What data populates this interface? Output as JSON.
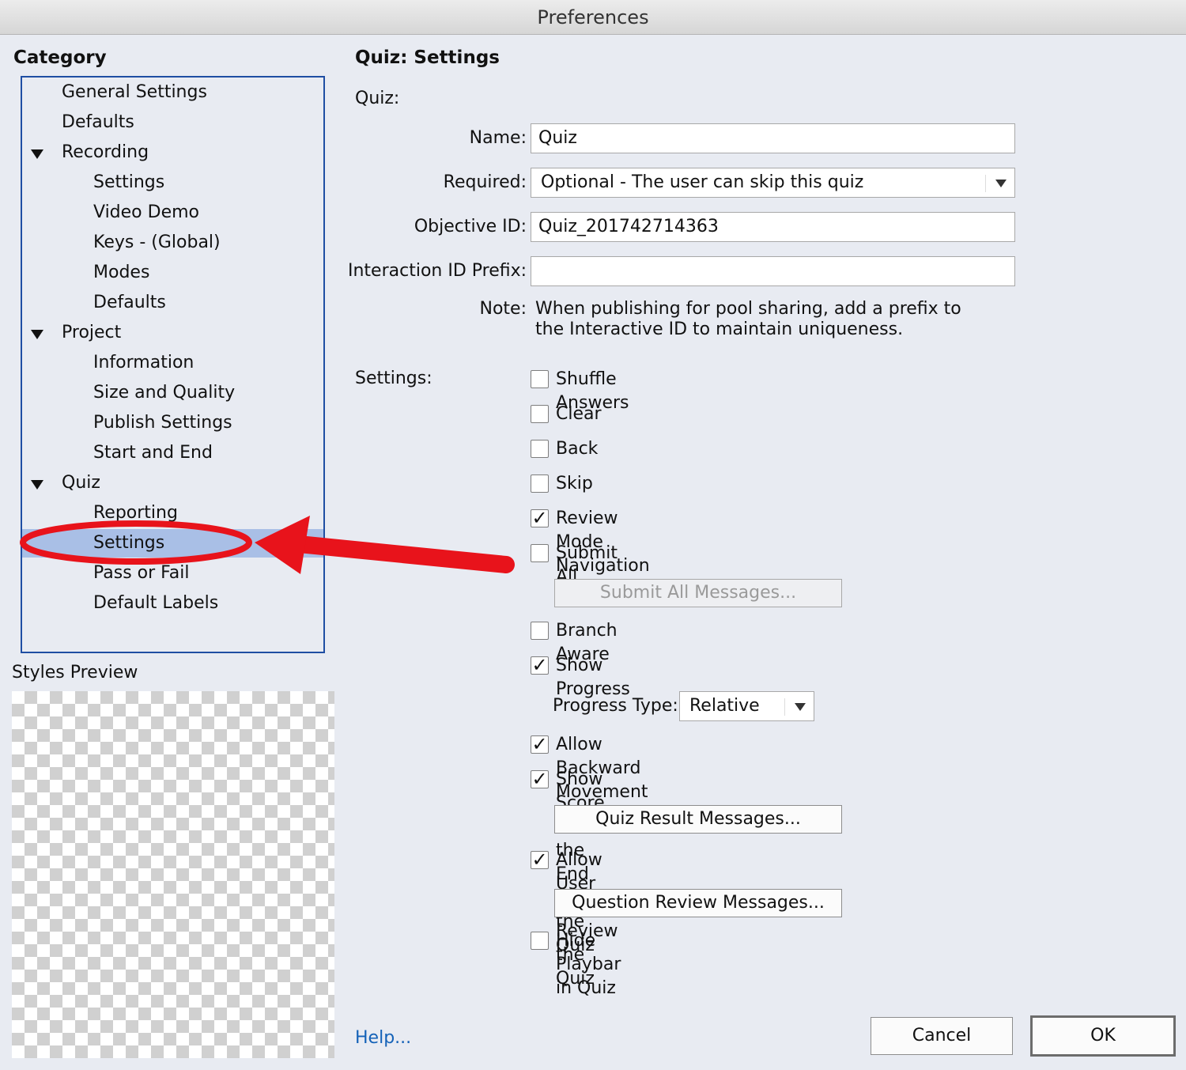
{
  "window": {
    "title": "Preferences"
  },
  "sidebar": {
    "heading": "Category",
    "items": [
      {
        "label": "General Settings"
      },
      {
        "label": "Defaults"
      },
      {
        "label": "Recording"
      },
      {
        "label": "Settings"
      },
      {
        "label": "Video Demo"
      },
      {
        "label": "Keys - (Global)"
      },
      {
        "label": "Modes"
      },
      {
        "label": "Defaults"
      },
      {
        "label": "Project"
      },
      {
        "label": "Information"
      },
      {
        "label": "Size and Quality"
      },
      {
        "label": "Publish Settings"
      },
      {
        "label": "Start and End"
      },
      {
        "label": "Quiz"
      },
      {
        "label": "Reporting"
      },
      {
        "label": "Settings"
      },
      {
        "label": "Pass or Fail"
      },
      {
        "label": "Default Labels"
      }
    ],
    "selected": "Settings",
    "preview_heading": "Styles Preview"
  },
  "panel": {
    "title": "Quiz: Settings",
    "section_quiz": "Quiz:",
    "name_label": "Name:",
    "name_value": "Quiz",
    "required_label": "Required:",
    "required_value": "Optional - The user can skip this quiz",
    "objective_label": "Objective ID:",
    "objective_value": "Quiz_201742714363",
    "prefix_label": "Interaction ID Prefix:",
    "prefix_value": "",
    "note_label": "Note:",
    "note_line1": "When publishing for pool sharing, add a prefix to",
    "note_line2": "the Interactive ID to maintain uniqueness.",
    "section_settings": "Settings:",
    "checks": {
      "shuffle": {
        "label": "Shuffle Answers",
        "checked": false
      },
      "clear": {
        "label": "Clear",
        "checked": false
      },
      "back": {
        "label": "Back",
        "checked": false
      },
      "skip": {
        "label": "Skip",
        "checked": false
      },
      "review_nav": {
        "label": "Review Mode Navigation Buttons",
        "checked": true
      },
      "submit_all": {
        "label": "Submit All",
        "checked": false
      },
      "branch": {
        "label": "Branch Aware",
        "checked": false
      },
      "show_progress": {
        "label": "Show Progress",
        "checked": true
      },
      "backward": {
        "label": "Allow Backward Movement",
        "checked": true
      },
      "show_score": {
        "label": "Show Score at the End of the Quiz",
        "checked": true
      },
      "allow_review": {
        "label": "Allow User to Review the Quiz",
        "checked": true
      },
      "hide_playbar": {
        "label": "Hide Playbar in Quiz",
        "checked": false
      }
    },
    "submit_all_messages_btn": "Submit All Messages...",
    "progress_type_label": "Progress Type:",
    "progress_type_value": "Relative",
    "quiz_result_btn": "Quiz Result Messages...",
    "question_review_btn": "Question Review Messages..."
  },
  "footer": {
    "help": "Help...",
    "cancel": "Cancel",
    "ok": "OK"
  },
  "check_glyph": "✓",
  "colors": {
    "selection": "#a9bfe6",
    "annotation": "#e8131b",
    "link": "#1462b8"
  }
}
